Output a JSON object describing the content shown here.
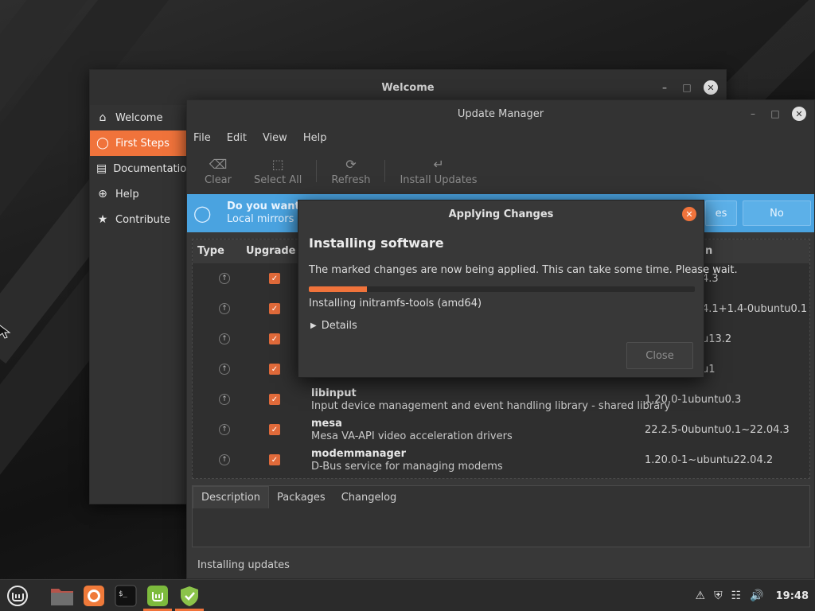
{
  "welcome": {
    "title": "Welcome",
    "sidebar": [
      {
        "label": "Welcome",
        "icon": "home-icon"
      },
      {
        "label": "First Steps",
        "icon": "lightbulb-icon",
        "active": true
      },
      {
        "label": "Documentation",
        "icon": "book-icon"
      },
      {
        "label": "Help",
        "icon": "help-icon"
      },
      {
        "label": "Contribute",
        "icon": "star-icon"
      }
    ]
  },
  "update_manager": {
    "title": "Update Manager",
    "menu": [
      "File",
      "Edit",
      "View",
      "Help"
    ],
    "toolbar": {
      "clear": "Clear",
      "select_all": "Select All",
      "refresh": "Refresh",
      "install_updates": "Install Updates"
    },
    "infobar": {
      "title": "Do you want t",
      "subtitle": "Local mirrors ar",
      "yes_label": "es",
      "no_label": "No"
    },
    "columns": {
      "type": "Type",
      "upgrade": "Upgrade",
      "version": "n"
    },
    "packages": [
      {
        "name": "",
        "description": "",
        "version": "4.3"
      },
      {
        "name": "",
        "description": "",
        "version": "4.1+1.4-0ubuntu0.1"
      },
      {
        "name": "",
        "description": "",
        "version": "u13.2"
      },
      {
        "name": "",
        "description": "",
        "version": "u1"
      },
      {
        "name": "libinput",
        "description": "Input device management and event handling library - shared library",
        "version": "1.20.0-1ubuntu0.3"
      },
      {
        "name": "mesa",
        "description": "Mesa VA-API video acceleration drivers",
        "version": "22.2.5-0ubuntu0.1~22.04.3"
      },
      {
        "name": "modemmanager",
        "description": "D-Bus service for managing modems",
        "version": "1.20.0-1~ubuntu22.04.2"
      }
    ],
    "tabs": [
      "Description",
      "Packages",
      "Changelog"
    ],
    "status": "Installing updates"
  },
  "dialog": {
    "title": "Applying Changes",
    "heading": "Installing software",
    "message": "The marked changes are now being applied. This can take some time. Please wait.",
    "progress_percent": 15,
    "status": "Installing initramfs-tools (amd64)",
    "details_label": "Details",
    "close_label": "Close"
  },
  "taskbar": {
    "clock": "19:48",
    "apps": [
      "mint-menu-icon",
      "files-icon",
      "firefox-icon",
      "terminal-icon",
      "mintwelcome-icon",
      "update-manager-icon"
    ],
    "tray": [
      "notification-icon",
      "shield-icon",
      "network-icon",
      "volume-icon"
    ]
  },
  "colors": {
    "accent": "#f0733b",
    "info": "#4aa3e0"
  }
}
